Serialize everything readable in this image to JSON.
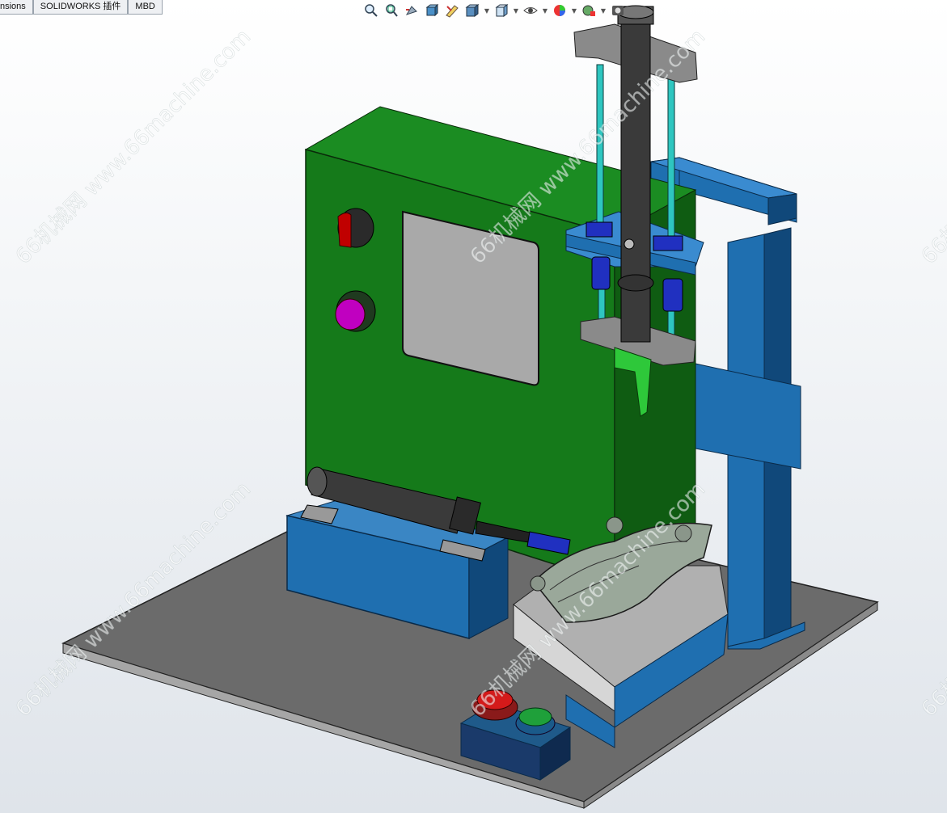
{
  "tabs": [
    {
      "label": "nsions"
    },
    {
      "label": "SOLIDWORKS 插件"
    },
    {
      "label": "MBD"
    }
  ],
  "hud_icons": [
    "zoom-to-fit-icon",
    "zoom-to-area-icon",
    "previous-view-icon",
    "section-view-icon",
    "dynamic-annotation-icon",
    "display-style-icon",
    "view-orientation-icon",
    "hide-show-items-icon",
    "edit-appearance-icon",
    "apply-scene-icon",
    "view-settings-icon"
  ],
  "watermark": {
    "text": "66机械网 www.66machine.com",
    "short": "66机"
  },
  "colors": {
    "cabinet_front": "#157a1a",
    "cabinet_side": "#0f5c12",
    "frame_blue": "#1f6fb0",
    "frame_blue_dark": "#10487a",
    "base_plate": "#6b6b6b",
    "cylinder": "#3a3a3a",
    "teal_rod": "#2ec6c0",
    "red_knob": "#c00000",
    "purple_button": "#c000c0",
    "green_button": "#1fa03a"
  }
}
